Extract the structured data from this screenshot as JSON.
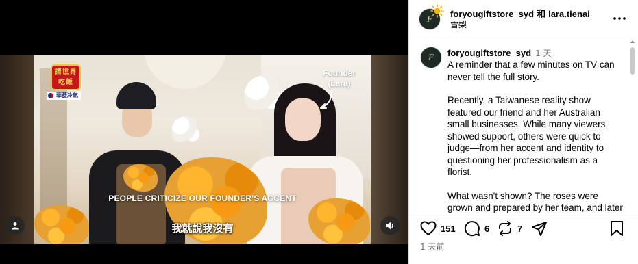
{
  "video": {
    "founder_label_line1": "Founder",
    "founder_label_line2": "(Lara)",
    "show_logo_line1": "請世界",
    "show_logo_line2": "吃飯",
    "sponsor": "華菱冷氣",
    "caption_en": "PEOPLE CRITICIZE OUR FOUNDER'S ACCENT",
    "caption_zh": "我就說我沒有"
  },
  "header": {
    "author": "foryougiftstore_syd",
    "conjunction": "和",
    "collaborator": "lara.tienai",
    "location": "雪梨"
  },
  "caption_post": {
    "username": "foryougiftstore_syd",
    "time": "1 天",
    "paragraphs": [
      "A reminder that a few minutes on TV can never tell the full story.",
      "Recently, a Taiwanese reality show featured our friend and her Australian small businesses. While many viewers showed support, others were quick to judge—from her accent and identity to questioning her professionalism as a florist.",
      "What wasn't shown? The roses were grown and prepared by her team, and later sold at"
    ]
  },
  "actions": {
    "likes": "151",
    "comments": "6",
    "reposts": "7"
  },
  "post_time": "1 天前",
  "colors": {
    "text": "#000000",
    "secondary": "#737373",
    "divider": "#efefef",
    "avatar_bg": "#1f2a26"
  },
  "icons": [
    "user-icon",
    "volume-icon",
    "more-icon",
    "heart-icon",
    "comment-icon",
    "repost-icon",
    "share-icon",
    "bookmark-icon",
    "sun-icon"
  ]
}
